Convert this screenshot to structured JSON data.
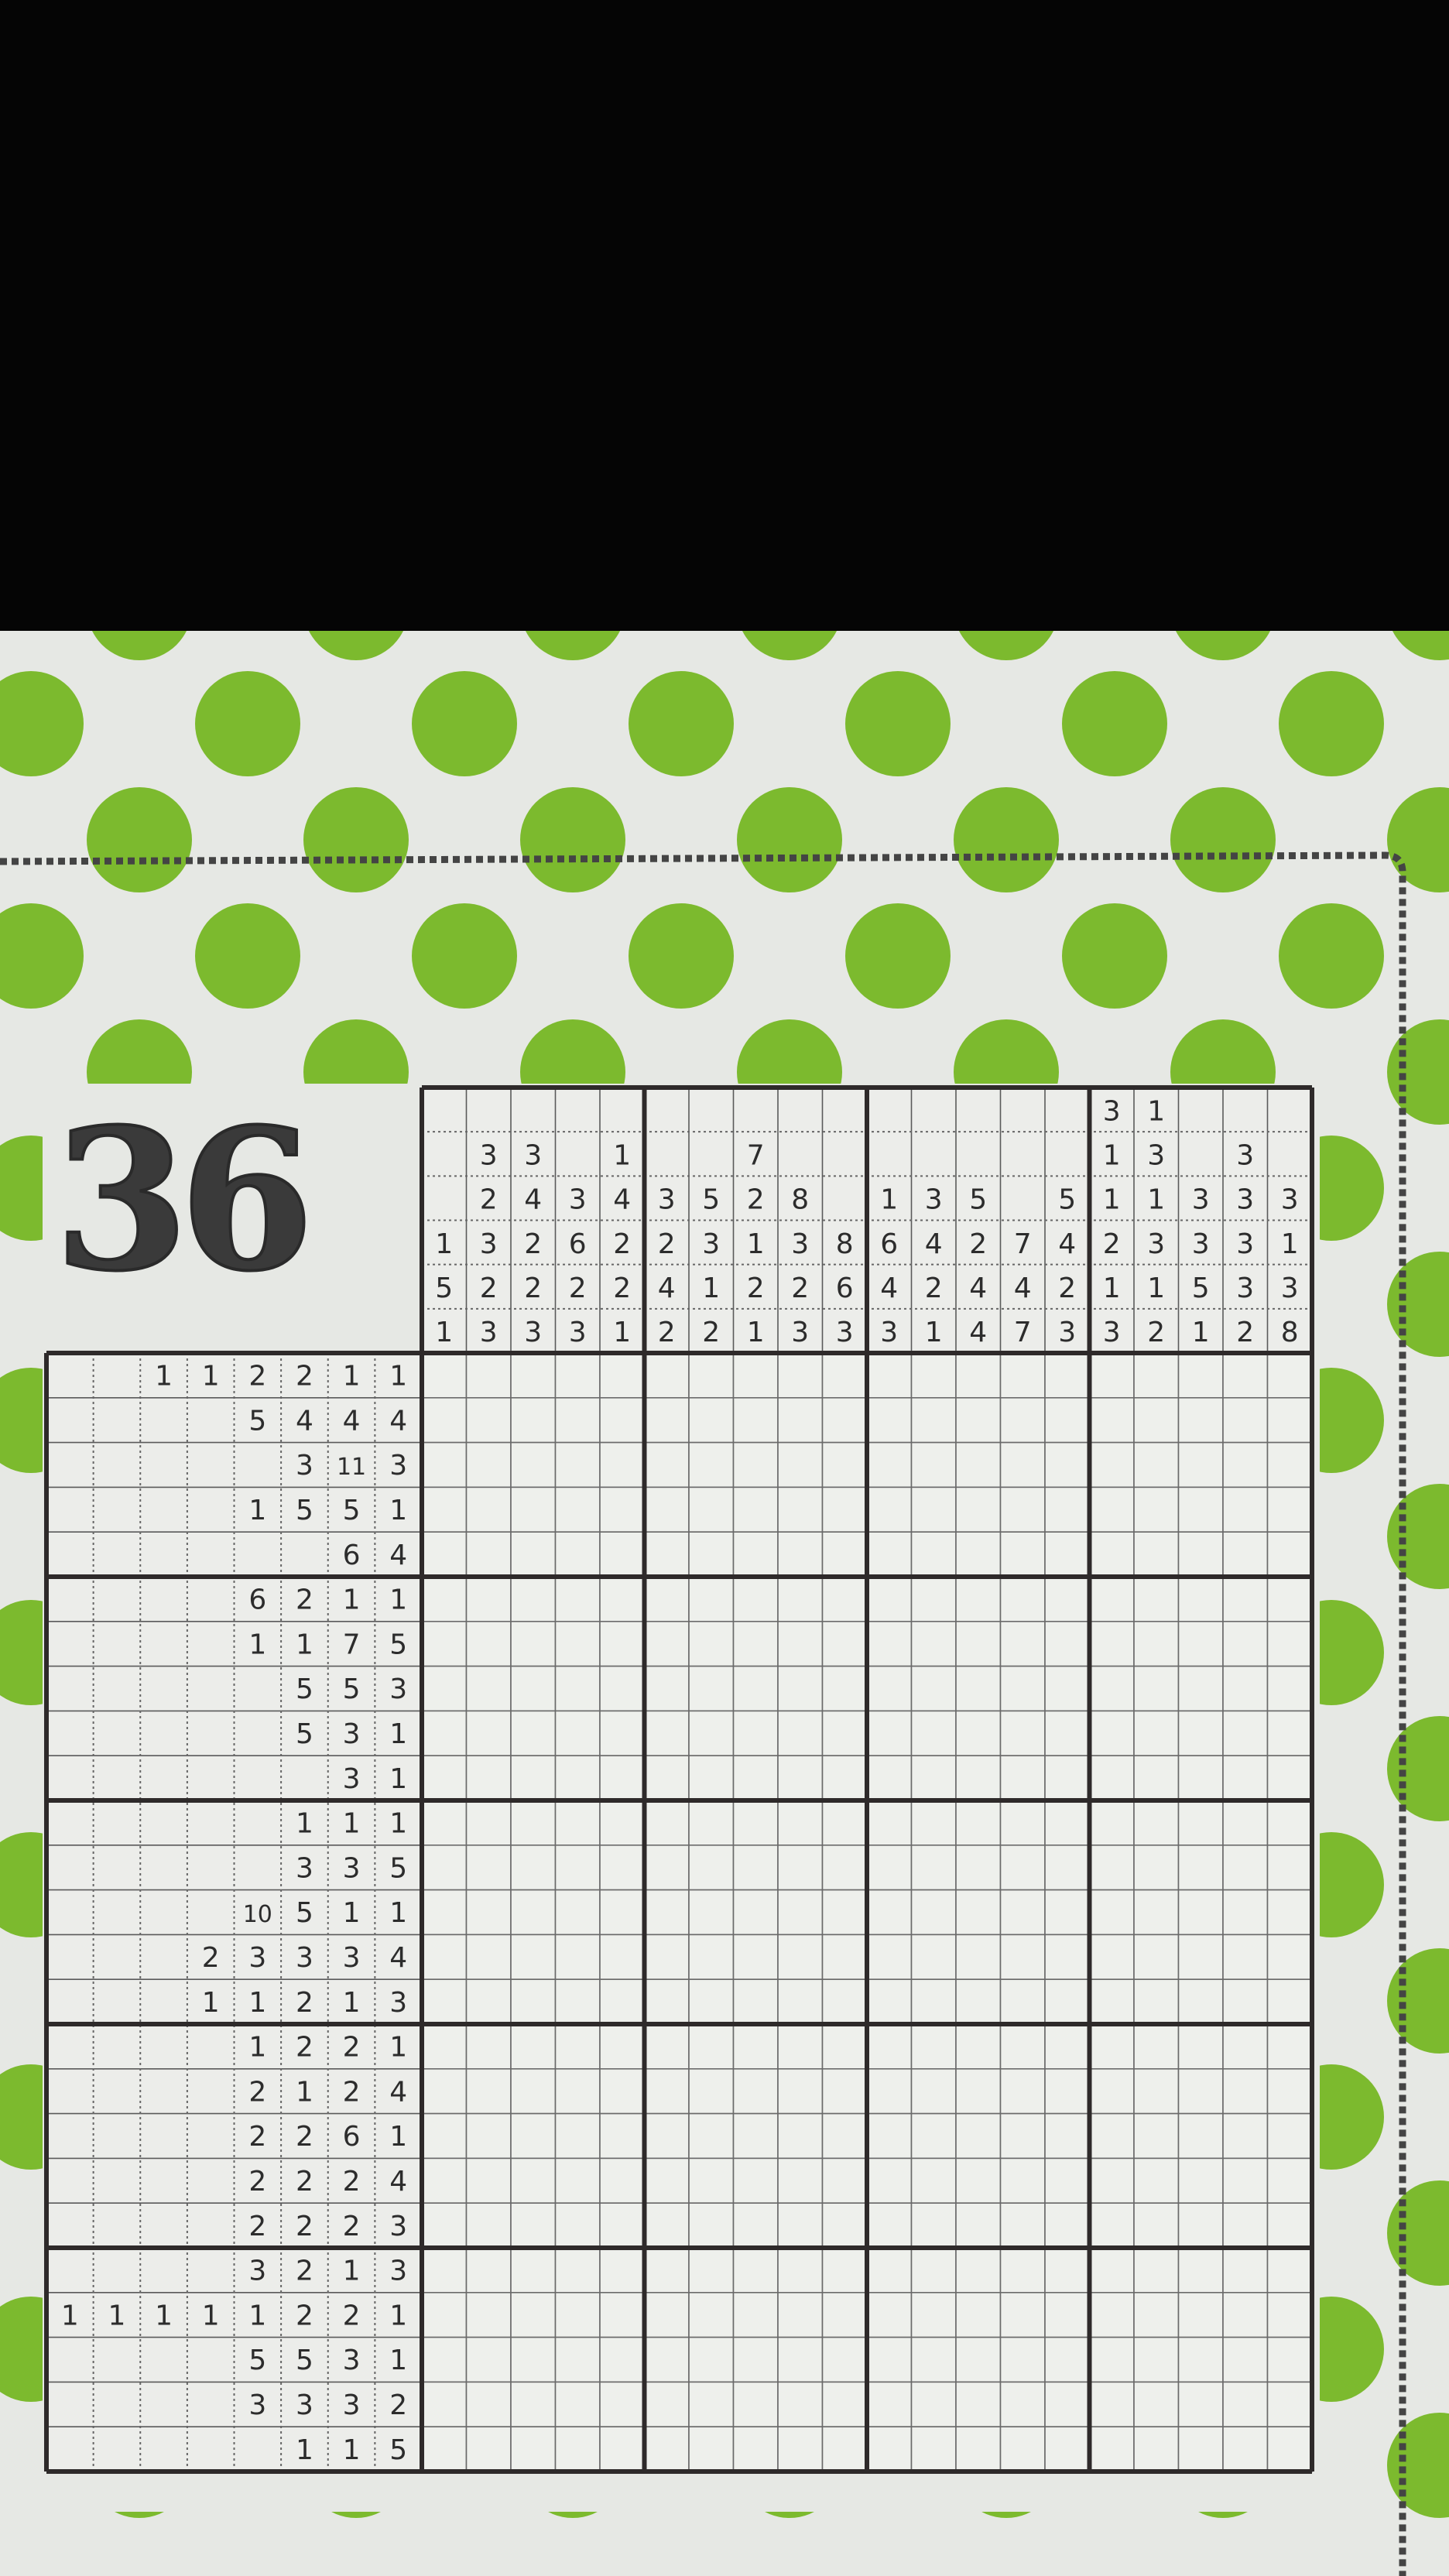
{
  "puzzle": {
    "number": "36",
    "type": "nonogram",
    "rows": 25,
    "columns": 20,
    "colors": {
      "paper": "#e6e8e4",
      "dots": "#7cba2e",
      "grid": "#2e2a2a",
      "background": "#050505"
    },
    "column_clues": [
      [
        "1",
        "5",
        "1"
      ],
      [
        "3",
        "2",
        "3",
        "2",
        "3"
      ],
      [
        "3",
        "4",
        "2",
        "2",
        "3"
      ],
      [
        "3",
        "6",
        "2",
        "3"
      ],
      [
        "1",
        "4",
        "2",
        "2",
        "1"
      ],
      [
        "3",
        "2",
        "4",
        "2"
      ],
      [
        "5",
        "3",
        "1",
        "2"
      ],
      [
        "7",
        "2",
        "1",
        "2",
        "1"
      ],
      [
        "8",
        "3",
        "2",
        "3"
      ],
      [
        "8",
        "6",
        "3"
      ],
      [
        "1",
        "6",
        "4",
        "3"
      ],
      [
        "3",
        "4",
        "2",
        "1"
      ],
      [
        "5",
        "2",
        "4",
        "4"
      ],
      [
        "7",
        "4",
        "7"
      ],
      [
        "5",
        "4",
        "2",
        "3"
      ],
      [
        "3",
        "1",
        "1",
        "2",
        "1",
        "3"
      ],
      [
        "1",
        "3",
        "1",
        "3",
        "1",
        "2"
      ],
      [
        "3",
        "3",
        "5",
        "1"
      ],
      [
        "3",
        "3",
        "3",
        "3",
        "2"
      ],
      [
        "3",
        "1",
        "3",
        "8"
      ]
    ],
    "row_clues": [
      [
        "1",
        "1",
        "2",
        "2",
        "1",
        "1"
      ],
      [
        "5",
        "4",
        "4",
        "4"
      ],
      [
        "3",
        "11",
        "3"
      ],
      [
        "1",
        "5",
        "5",
        "1"
      ],
      [
        "6",
        "4"
      ],
      [
        "6",
        "2",
        "1",
        "1"
      ],
      [
        "1",
        "1",
        "7",
        "5"
      ],
      [
        "5",
        "5",
        "3"
      ],
      [
        "5",
        "3",
        "1"
      ],
      [
        "3",
        "1"
      ],
      [
        "1",
        "1",
        "1"
      ],
      [
        "3",
        "3",
        "5"
      ],
      [
        "10",
        "5",
        "1",
        "1"
      ],
      [
        "2",
        "3",
        "3",
        "3",
        "4"
      ],
      [
        "1",
        "1",
        "2",
        "1",
        "3"
      ],
      [
        "1",
        "2",
        "2",
        "1"
      ],
      [
        "2",
        "1",
        "2",
        "4"
      ],
      [
        "2",
        "2",
        "6",
        "1"
      ],
      [
        "2",
        "2",
        "2",
        "4"
      ],
      [
        "2",
        "2",
        "2",
        "3"
      ],
      [
        "3",
        "2",
        "1",
        "3"
      ],
      [
        "1",
        "1",
        "1",
        "1",
        "1",
        "2",
        "2",
        "1"
      ],
      [
        "5",
        "5",
        "3",
        "1"
      ],
      [
        "3",
        "3",
        "3",
        "2"
      ],
      [
        "1",
        "1",
        "5"
      ]
    ]
  }
}
